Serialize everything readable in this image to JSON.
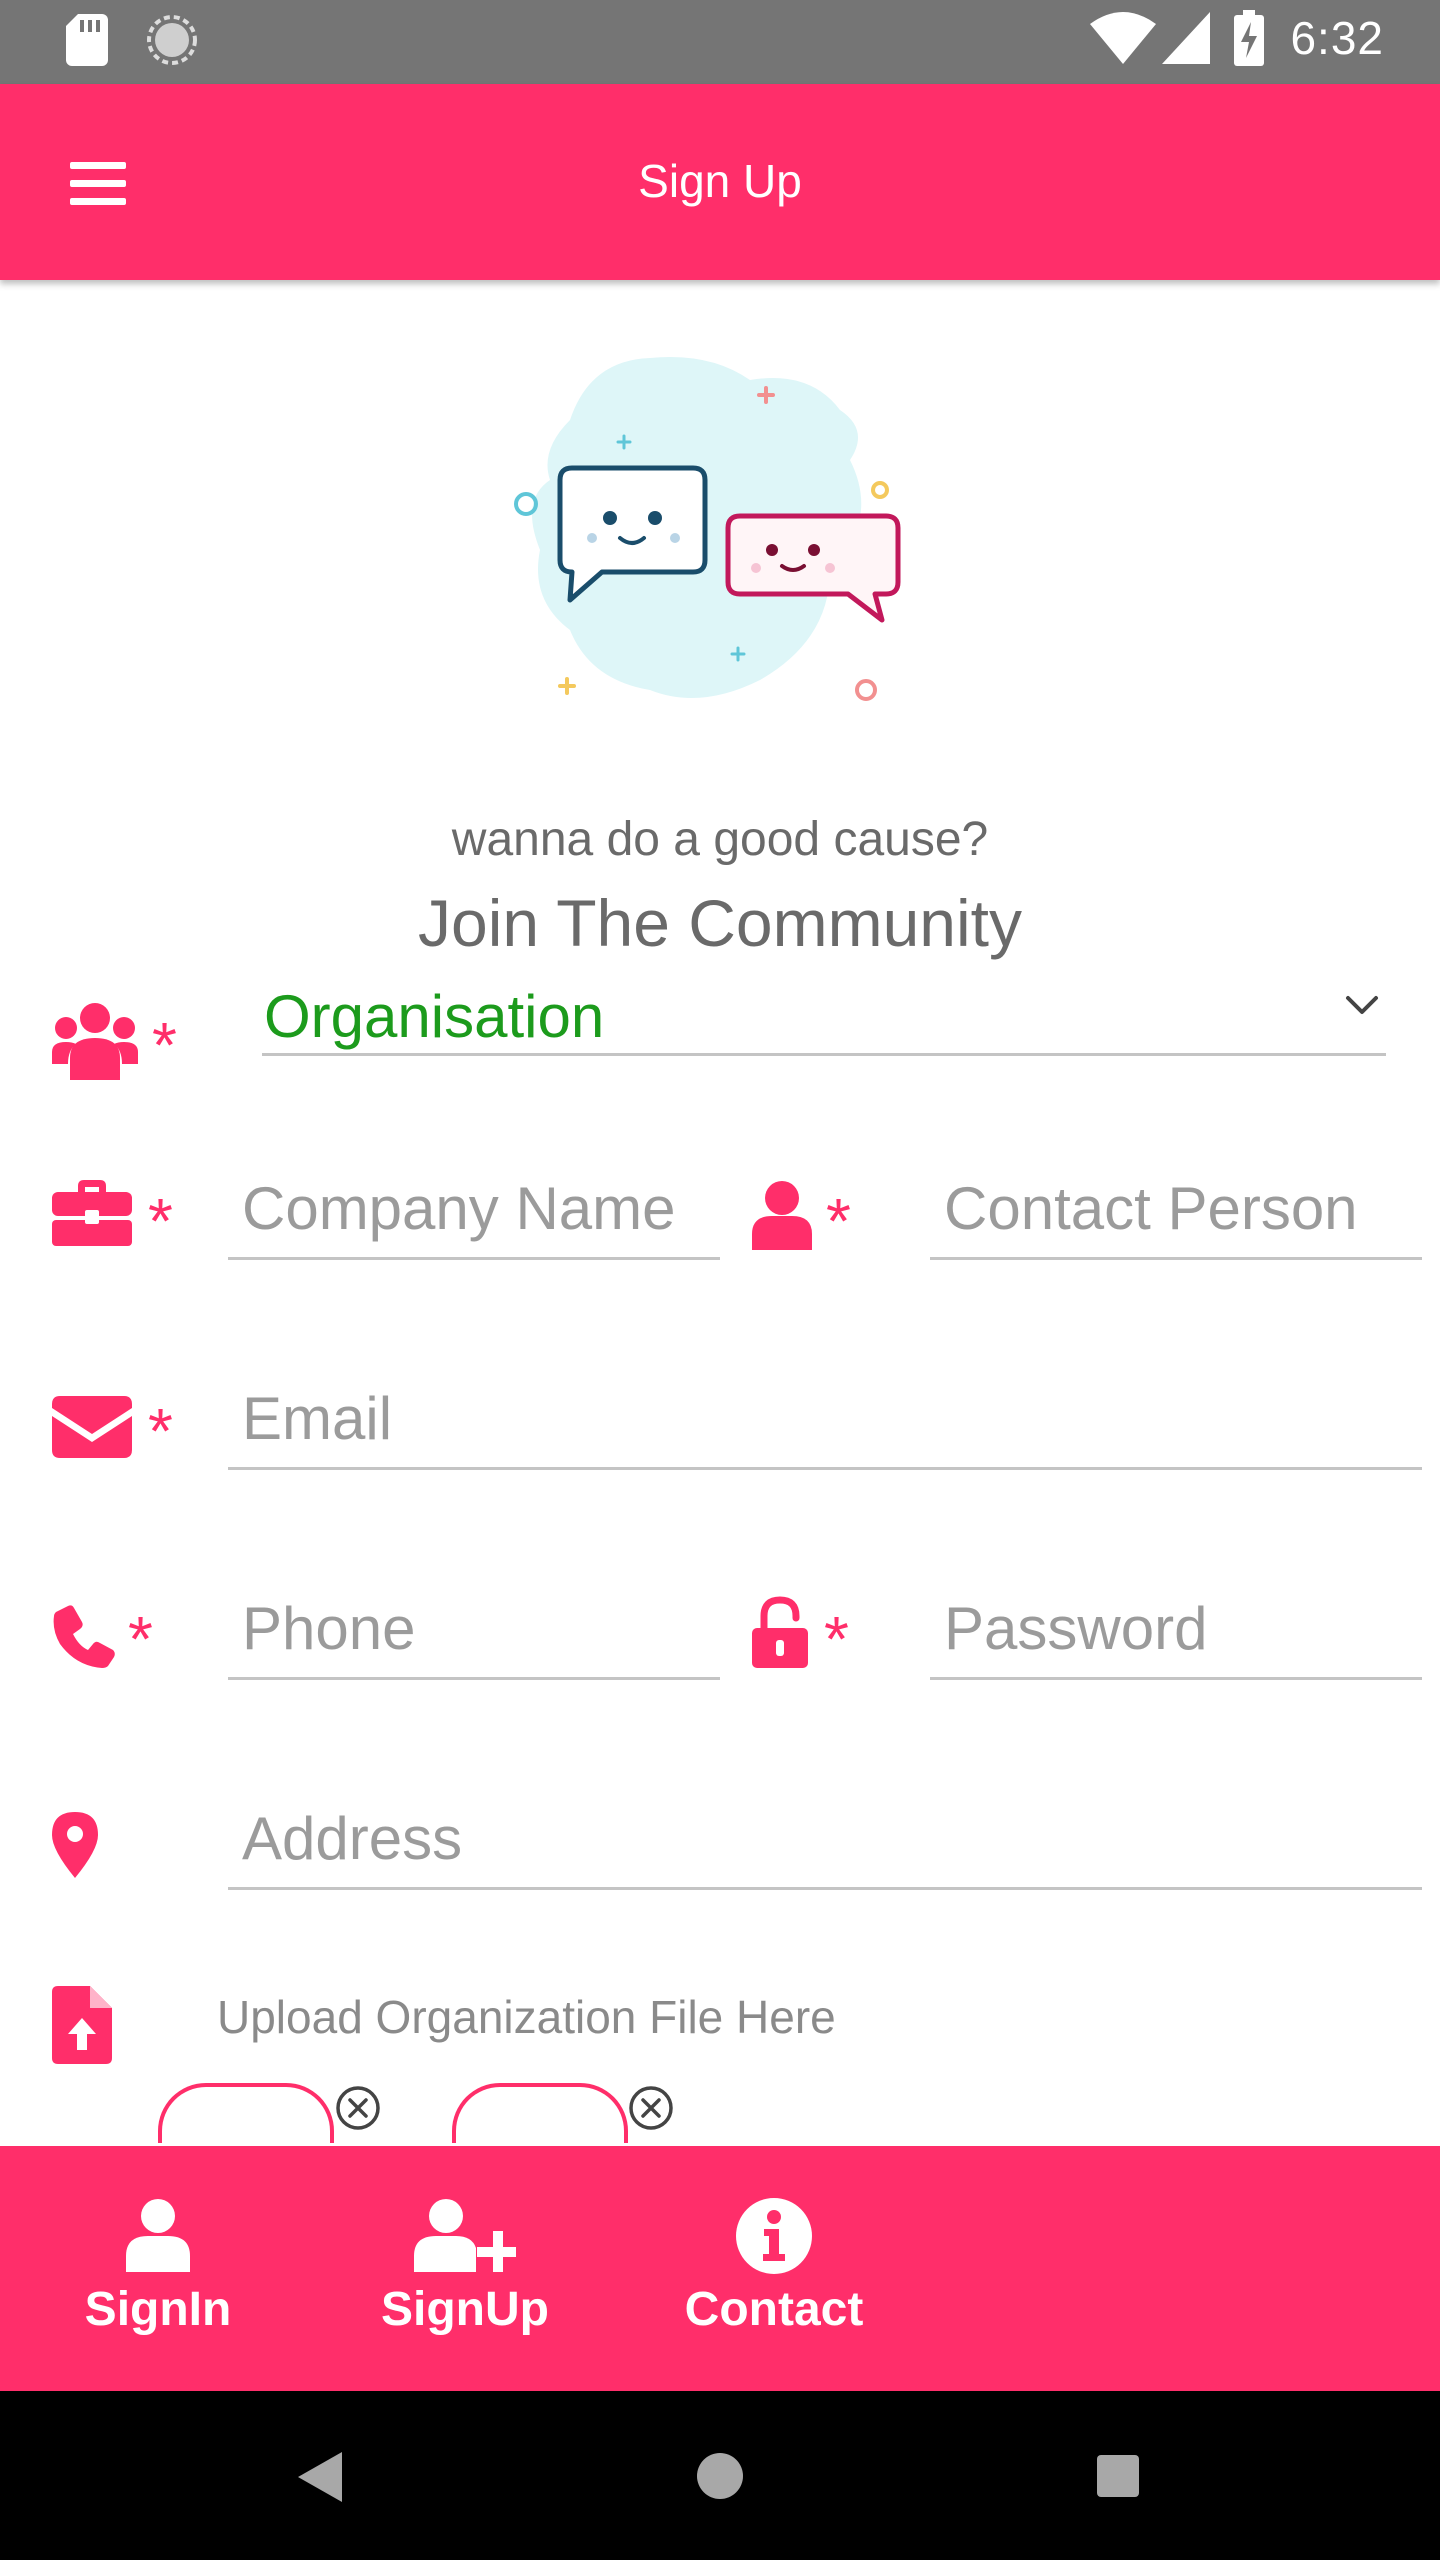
{
  "status_bar": {
    "time": "6:32"
  },
  "app_bar": {
    "title": "Sign Up",
    "menu_icon": "hamburger-menu-icon"
  },
  "hero": {
    "illustration": "chat-bubbles-illustration"
  },
  "header": {
    "subtitle": "wanna do a good cause?",
    "title": "Join The Community"
  },
  "form": {
    "account_type": {
      "value": "Organisation",
      "icon": "users-group-icon",
      "required_mark": "*"
    },
    "company_name": {
      "placeholder": "Company Name",
      "icon": "briefcase-icon",
      "required_mark": "*"
    },
    "contact_person": {
      "placeholder": "Contact Person",
      "icon": "user-icon",
      "required_mark": "*"
    },
    "email": {
      "placeholder": "Email",
      "icon": "envelope-icon",
      "required_mark": "*"
    },
    "phone": {
      "placeholder": "Phone",
      "icon": "phone-icon",
      "required_mark": "*"
    },
    "password": {
      "placeholder": "Password",
      "icon": "unlock-icon",
      "required_mark": "*"
    },
    "address": {
      "placeholder": "Address",
      "icon": "map-pin-icon"
    },
    "upload": {
      "label": "Upload Organization File Here",
      "icon": "file-upload-icon"
    }
  },
  "bottom_nav": {
    "items": [
      {
        "label": "SignIn",
        "icon": "user-icon"
      },
      {
        "label": "SignUp",
        "icon": "user-plus-icon"
      },
      {
        "label": "Contact",
        "icon": "info-circle-icon"
      }
    ]
  },
  "colors": {
    "accent": "#ff2e6a",
    "status_bar": "#757575",
    "selected_value": "#1c9b1c",
    "placeholder": "#9b9b9b",
    "text_muted": "#6a6a6a"
  }
}
